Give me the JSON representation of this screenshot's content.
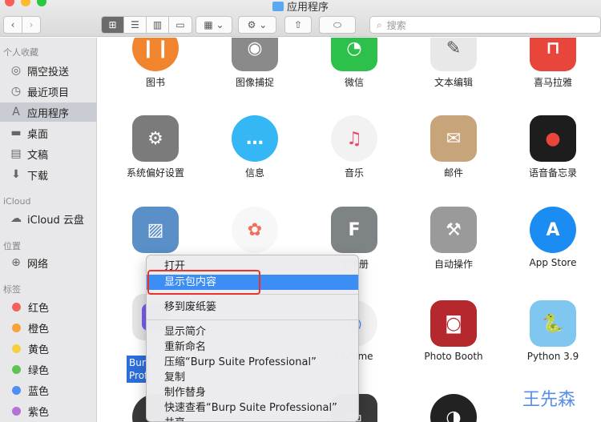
{
  "window": {
    "title": "应用程序"
  },
  "toolbar": {
    "back_glyph": "‹",
    "forward_glyph": "›",
    "view_icons": [
      "grid-icon",
      "list-icon",
      "column-icon",
      "gallery-icon"
    ],
    "group_glyph": "▦ ⌄",
    "action_glyph": "⚙ ⌄",
    "share_glyph": "⇧",
    "tag_glyph": "⬭",
    "search_placeholder": "搜索"
  },
  "sidebar": {
    "favorites_title": "个人收藏",
    "favorites": [
      {
        "label": "隔空投送",
        "icon": "airdrop-icon",
        "glyph": "◎"
      },
      {
        "label": "最近项目",
        "icon": "clock-icon",
        "glyph": "◷"
      },
      {
        "label": "应用程序",
        "icon": "applications-icon",
        "glyph": "A"
      },
      {
        "label": "桌面",
        "icon": "desktop-icon",
        "glyph": "▬"
      },
      {
        "label": "文稿",
        "icon": "document-icon",
        "glyph": "▤"
      },
      {
        "label": "下载",
        "icon": "download-icon",
        "glyph": "⬇"
      }
    ],
    "icloud_title": "iCloud",
    "icloud": [
      {
        "label": "iCloud 云盘",
        "icon": "cloud-icon",
        "glyph": "☁"
      }
    ],
    "locations_title": "位置",
    "locations": [
      {
        "label": "网络",
        "icon": "network-icon",
        "glyph": "⊕"
      }
    ],
    "tags_title": "标签",
    "tags": [
      {
        "label": "红色",
        "color": "#f4615a"
      },
      {
        "label": "橙色",
        "color": "#f5a23a"
      },
      {
        "label": "黄色",
        "color": "#f5cf3d"
      },
      {
        "label": "绿色",
        "color": "#5dc451"
      },
      {
        "label": "蓝色",
        "color": "#4f8ef5"
      },
      {
        "label": "紫色",
        "color": "#b472d9"
      }
    ]
  },
  "apps": [
    {
      "label": "图书",
      "icon": "books-icon",
      "color": "#f0852d",
      "glyph": "❙❙"
    },
    {
      "label": "图像捕捉",
      "icon": "image-capture-icon",
      "color": "#8a8a8a",
      "glyph": "◉"
    },
    {
      "label": "微信",
      "icon": "wechat-icon",
      "color": "#2dc14b",
      "glyph": "◔"
    },
    {
      "label": "文本编辑",
      "icon": "textedit-icon",
      "color": "#e8e8e8",
      "glyph": "✎"
    },
    {
      "label": "喜马拉雅",
      "icon": "ximalaya-icon",
      "color": "#e8463b",
      "glyph": "⊓"
    },
    {
      "label": "系统偏好设置",
      "icon": "system-preferences-icon",
      "color": "#7b7b7b",
      "glyph": "⚙"
    },
    {
      "label": "信息",
      "icon": "messages-icon",
      "color": "#35b6f5",
      "glyph": "…"
    },
    {
      "label": "音乐",
      "icon": "music-icon",
      "color": "#f2f2f2",
      "glyph": "♫"
    },
    {
      "label": "邮件",
      "icon": "mail-icon",
      "color": "#c7a47a",
      "glyph": "✉"
    },
    {
      "label": "语音备忘录",
      "icon": "voice-memos-icon",
      "color": "#1d1d1d",
      "glyph": "●"
    },
    {
      "label": "",
      "icon": "preview-icon",
      "color": "#5a8fc8",
      "glyph": "▨"
    },
    {
      "label": "",
      "icon": "photos-icon",
      "color": "#f7f7f7",
      "glyph": "✿"
    },
    {
      "label": "字体册",
      "icon": "font-book-icon",
      "color": "#7e8486",
      "glyph": "F"
    },
    {
      "label": "自动操作",
      "icon": "automator-icon",
      "color": "#9a9a9a",
      "glyph": "⚒"
    },
    {
      "label": "App Store",
      "icon": "app-store-icon",
      "color": "#1b8cf2",
      "glyph": "A"
    },
    {
      "label": "Burp Suite Professional",
      "icon": "burp-suite-icon",
      "color": "#f0f0f0",
      "glyph": ""
    },
    {
      "label": "Chrome",
      "icon": "chrome-icon",
      "color": "#f2f2f2",
      "glyph": "◍"
    },
    {
      "label": "Photo Booth",
      "icon": "photo-booth-icon",
      "color": "#b5282e",
      "glyph": "◙"
    },
    {
      "label": "Python 3.9",
      "icon": "python-folder-icon",
      "color": "#7fc7f0",
      "glyph": "🐍"
    },
    {
      "label": "",
      "icon": "terminal-icon",
      "color": "#3b3b3b",
      "glyph": "▭"
    },
    {
      "label": "",
      "icon": "siri-icon",
      "color": "#222",
      "glyph": "◑"
    }
  ],
  "selected_app_label": {
    "line1": "Bur",
    "line2": "Prof"
  },
  "context_menu": {
    "items": [
      "打开",
      "显示包内容",
      "移到废纸篓",
      "显示简介",
      "重新命名",
      "压缩“Burp Suite Professional”",
      "复制",
      "制作替身",
      "快速查看“Burp Suite Professional”",
      "共享"
    ]
  },
  "watermark": "王先森"
}
